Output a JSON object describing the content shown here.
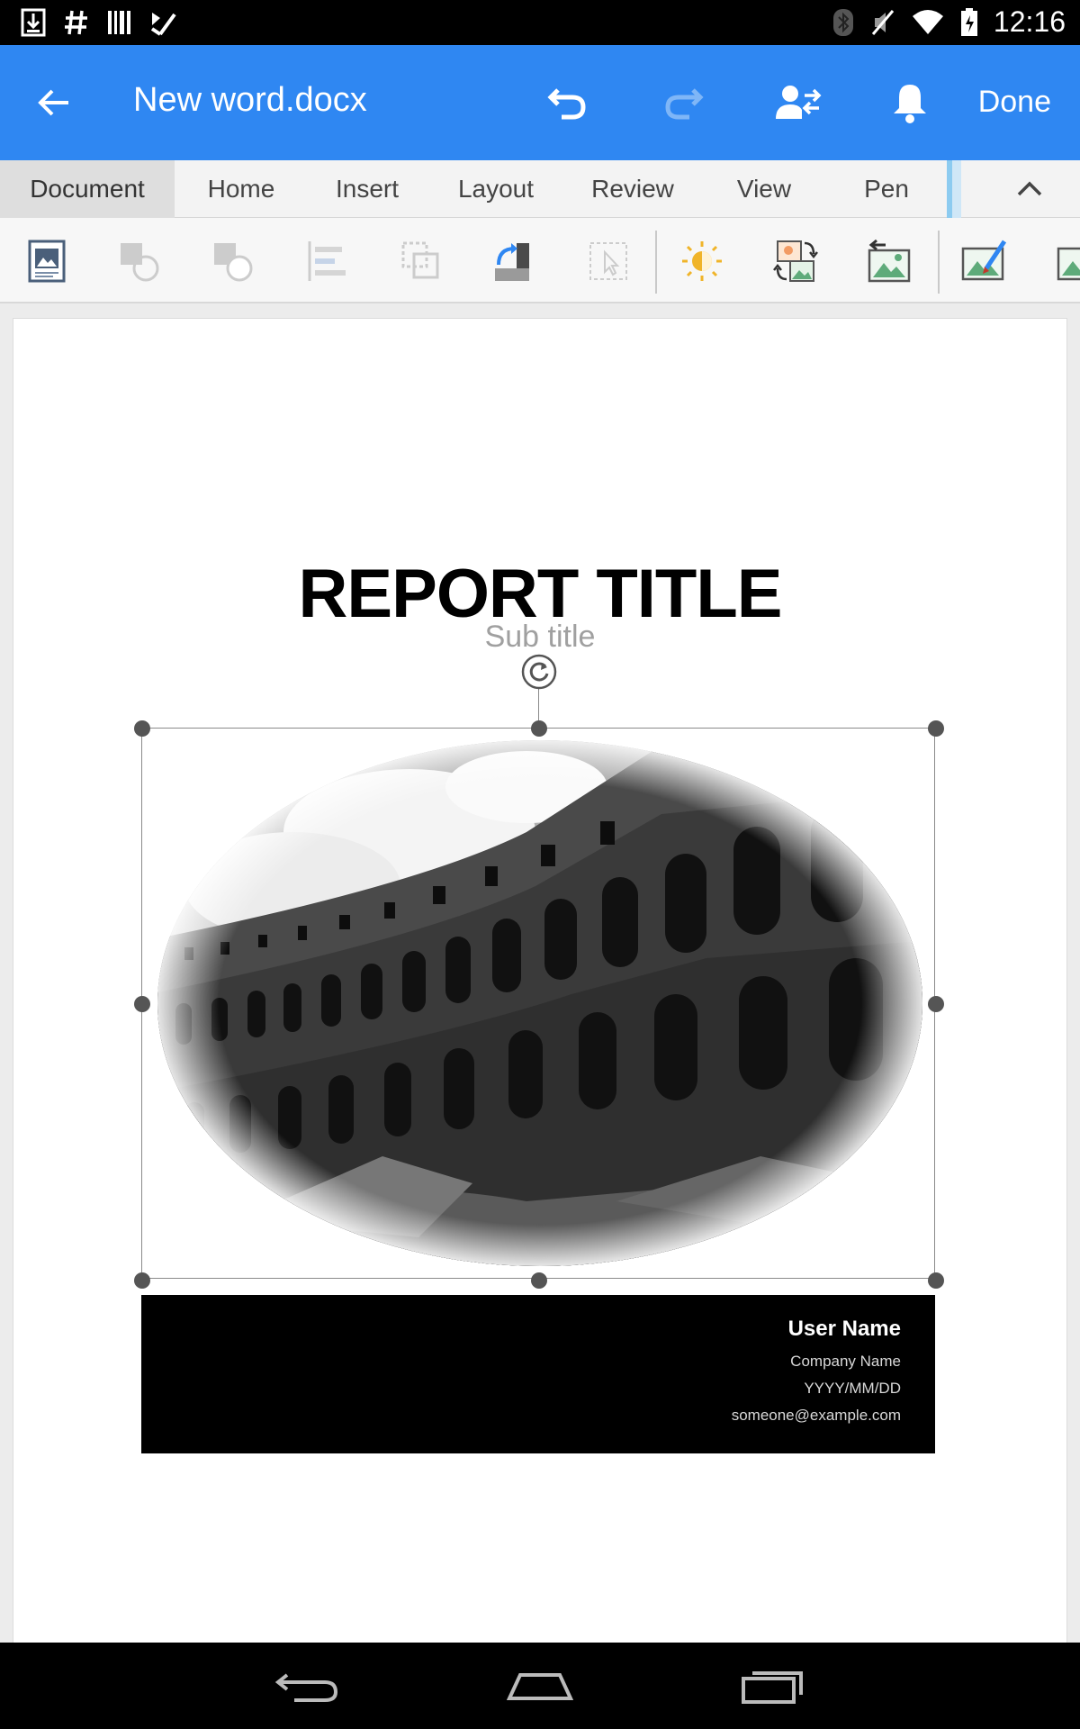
{
  "status_bar": {
    "time": "12:16",
    "left_icons": [
      "download-icon",
      "hash-icon",
      "barcode-icon",
      "checklist-icon"
    ],
    "right_icons": [
      "bluetooth-icon",
      "mute-icon",
      "wifi-icon",
      "battery-icon"
    ]
  },
  "app_bar": {
    "title": "New word.docx",
    "done_label": "Done",
    "background": "#2f87f2"
  },
  "tabs": [
    {
      "label": "Document",
      "active": true
    },
    {
      "label": "Home",
      "active": false
    },
    {
      "label": "Insert",
      "active": false
    },
    {
      "label": "Layout",
      "active": false
    },
    {
      "label": "Review",
      "active": false
    },
    {
      "label": "View",
      "active": false
    },
    {
      "label": "Pen",
      "active": false
    }
  ],
  "toolbar": {
    "buttons": [
      "picture-style-icon",
      "bring-forward-icon",
      "send-backward-icon",
      "align-icon",
      "group-icon",
      "rotate-icon",
      "select-object-icon",
      "brightness-icon",
      "change-picture-icon",
      "reset-picture-icon",
      "picture-effects-icon",
      "picture-more-icon"
    ]
  },
  "document": {
    "title": "REPORT TITLE",
    "subtitle": "Sub title",
    "user_name": "User Name",
    "company_name": "Company Name",
    "date": "YYYY/MM/DD",
    "email": "someone@example.com"
  },
  "nav_bar": {
    "buttons": [
      "back-nav-icon",
      "home-nav-icon",
      "recents-nav-icon"
    ]
  }
}
